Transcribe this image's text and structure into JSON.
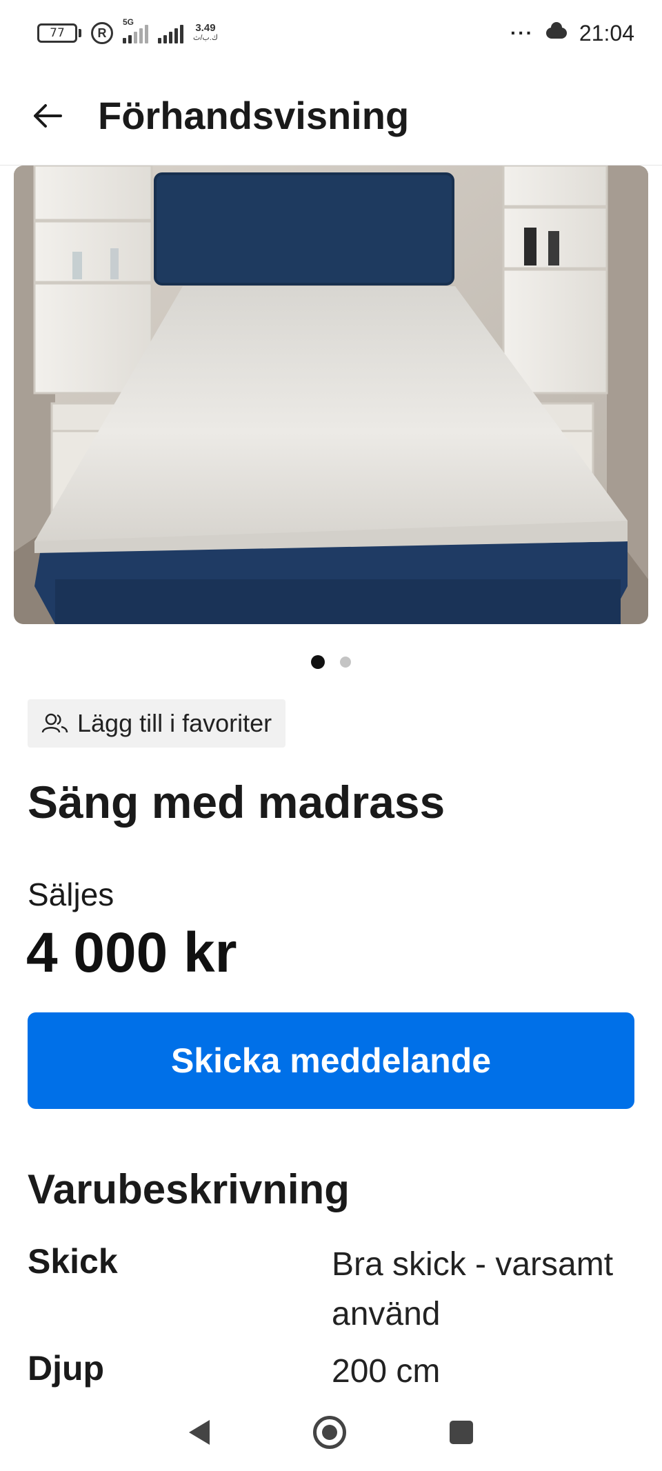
{
  "status_bar": {
    "battery": "77",
    "network_type": "5G",
    "speed_value": "3.49",
    "speed_unit": "ك.ب/ث",
    "more_icon": "more-dots-icon",
    "weather_icon": "cloud-icon",
    "time": "21:04"
  },
  "header": {
    "back_icon": "arrow-left-icon",
    "title": "Förhandsvisning"
  },
  "gallery": {
    "image_count": 2,
    "active_index": 0
  },
  "favorite": {
    "icon": "users-icon",
    "label": "Lägg till i favoriter"
  },
  "listing": {
    "title": "Säng med madrass",
    "sale_type": "Säljes",
    "price": "4 000 kr"
  },
  "actions": {
    "message_label": "Skicka meddelande"
  },
  "description": {
    "heading": "Varubeskrivning",
    "specs": [
      {
        "label": "Skick",
        "value": "Bra skick - varsamt använd"
      },
      {
        "label": "Djup",
        "value": "200 cm"
      }
    ]
  },
  "nav_bar": {
    "back_icon": "nav-back-icon",
    "home_icon": "nav-home-icon",
    "recent_icon": "nav-recents-icon"
  },
  "colors": {
    "primary_button": "#0070e8",
    "headboard": "#1e3a5f",
    "mattress": "#e8e6e1"
  }
}
